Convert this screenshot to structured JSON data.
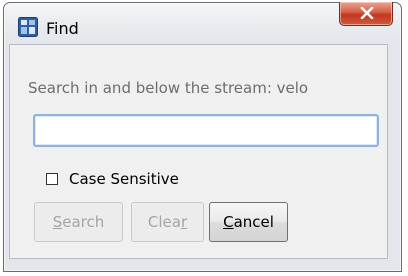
{
  "window": {
    "title": "Find",
    "app_icon": "find-window-icon",
    "close_icon": "close-icon"
  },
  "dialog": {
    "prompt": "Search in and below the stream: velo",
    "search_input": {
      "value": "",
      "placeholder": ""
    },
    "case_sensitive": {
      "label": "Case Sensitive",
      "checked": false
    }
  },
  "buttons": {
    "search": {
      "pre": "",
      "mnemonic": "S",
      "post": "earch",
      "enabled": false
    },
    "clear": {
      "pre": "Clea",
      "mnemonic": "r",
      "post": "",
      "enabled": false
    },
    "cancel": {
      "pre": "",
      "mnemonic": "C",
      "post": "ancel",
      "enabled": true
    }
  },
  "colors": {
    "close_button": "#c2381f",
    "input_border": "#8fb4d8",
    "prompt_text": "#6d6d6d",
    "disabled_text": "#a4a4a4"
  }
}
